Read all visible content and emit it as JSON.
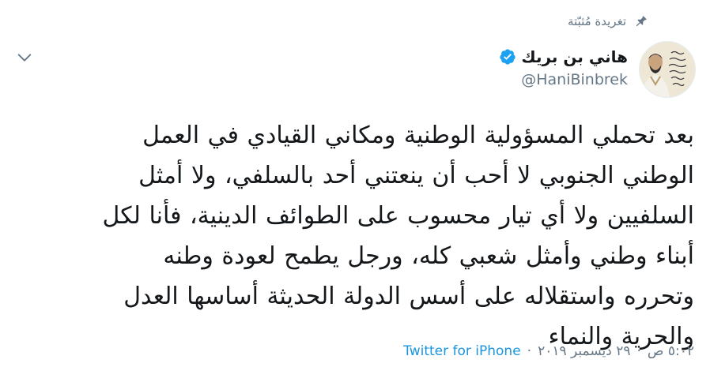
{
  "pinned": {
    "label": "تغريدة مُثبّتة",
    "icon": "pin-icon"
  },
  "author": {
    "display_name": "هاني بن بريك",
    "handle": "@HaniBinbrek",
    "verified": true,
    "verified_icon": "verified-badge-icon",
    "avatar_icon": "avatar"
  },
  "menu": {
    "icon": "chevron-down-icon"
  },
  "tweet": {
    "lines": [
      "بعد تحملي المسؤولية الوطنية ومكاني القيادي في العمل",
      "الوطني الجنوبي لا أحب أن ينعتني أحد بالسلفي، ولا أمثل",
      "السلفيين ولا أي تيار محسوب على الطوائف الدينية، فأنا لكل",
      "أبناء وطني وأمثل شعبي كله، ورجل يطمح لعودة وطنه",
      "وتحرره واستقلاله على أسس الدولة الحديثة أساسها العدل",
      "والحرية والنماء"
    ]
  },
  "meta": {
    "time": "٥:٠٢ ص",
    "separator": "·",
    "date": "٢٩ ديسمبر ٢٠١٩",
    "source": "Twitter for iPhone"
  },
  "colors": {
    "text": "#14171a",
    "secondary": "#657786",
    "link": "#1b95e0",
    "verified": "#1da1f2"
  }
}
